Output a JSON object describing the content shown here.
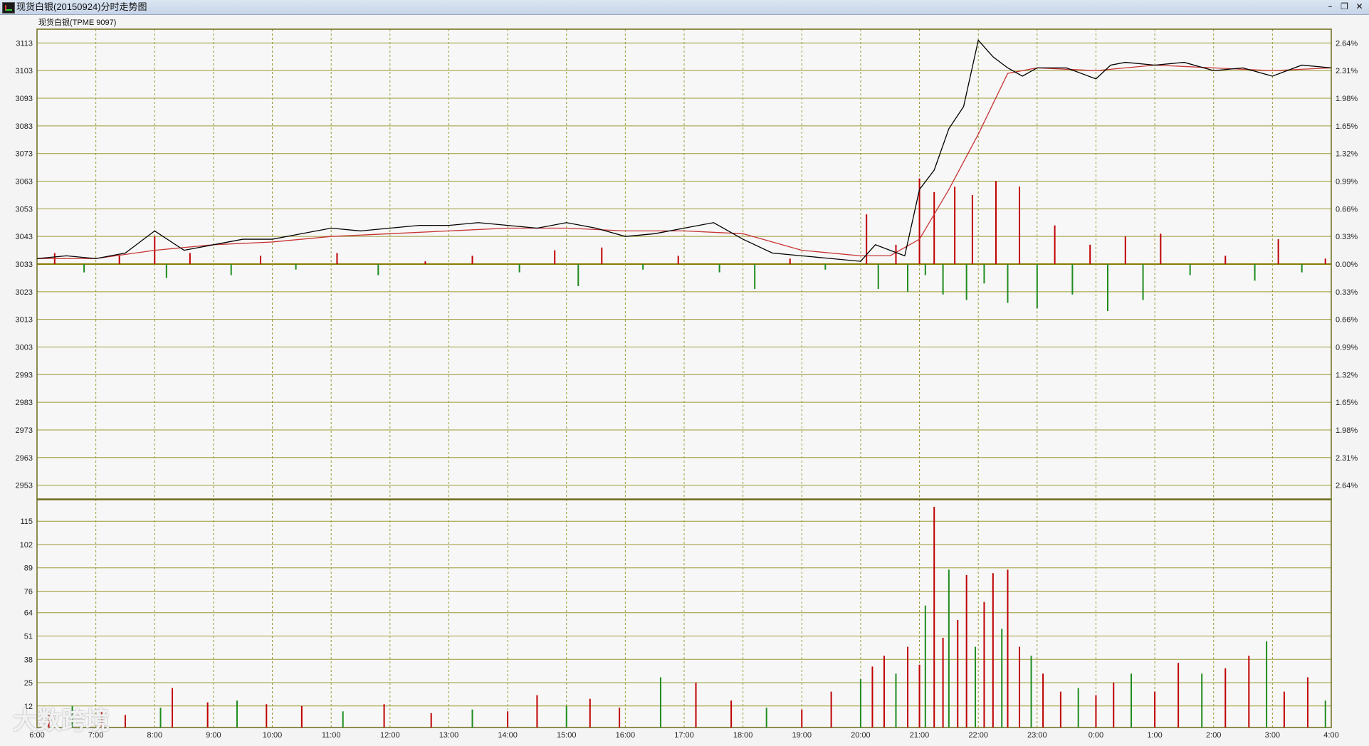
{
  "window": {
    "title": "现货白银(20150924)分时走势图",
    "buttons": {
      "minimize": "–",
      "restore": "❐",
      "close": "✕"
    }
  },
  "chart_label": "现货白银(TPME 9097)",
  "watermark": "大数跨境",
  "colors": {
    "up": "#c00000",
    "down": "#1e8c1e",
    "grid": "#999933",
    "price": "#000000",
    "avg": "#c83232",
    "base": "#8a7a00"
  },
  "chart_data": [
    {
      "type": "line",
      "title": "现货白银(TPME 9097)",
      "x_ticks": [
        "6:00",
        "7:00",
        "8:00",
        "9:00",
        "10:00",
        "11:00",
        "12:00",
        "13:00",
        "14:00",
        "15:00",
        "16:00",
        "17:00",
        "18:00",
        "19:00",
        "20:00",
        "21:00",
        "22:00",
        "23:00",
        "0:00",
        "1:00",
        "2:00",
        "3:00",
        "4:00"
      ],
      "y_ticks_left": [
        "3113",
        "3103",
        "3093",
        "3083",
        "3073",
        "3063",
        "3053",
        "3043",
        "3033",
        "3023",
        "3013",
        "3003",
        "2993",
        "2983",
        "2973",
        "2963",
        "2953"
      ],
      "y_ticks_right": [
        "2.64%",
        "2.31%",
        "1.98%",
        "1.65%",
        "1.32%",
        "0.99%",
        "0.66%",
        "0.33%",
        "0.00%",
        "0.33%",
        "0.66%",
        "0.99%",
        "1.32%",
        "1.65%",
        "1.98%",
        "2.31%",
        "2.64%"
      ],
      "ylim": [
        2948,
        3118
      ],
      "base_price": 3033,
      "grid": true,
      "series": [
        {
          "kind": "price",
          "x": [
            6.0,
            6.5,
            7.0,
            7.5,
            8.0,
            8.5,
            9.0,
            9.5,
            10.0,
            10.5,
            11.0,
            11.5,
            12.0,
            12.5,
            13.0,
            13.5,
            14.0,
            14.5,
            15.0,
            15.5,
            16.0,
            16.5,
            17.0,
            17.5,
            18.0,
            18.5,
            19.0,
            19.5,
            20.0,
            20.25,
            20.5,
            20.75,
            21.0,
            21.25,
            21.5,
            21.75,
            22.0,
            22.25,
            22.5,
            22.75,
            23.0,
            23.5,
            24.0,
            24.25,
            24.5,
            25.0,
            25.5,
            26.0,
            26.5,
            27.0,
            27.5,
            28.0
          ],
          "y": [
            3035,
            3036,
            3035,
            3037,
            3045,
            3038,
            3040,
            3042,
            3042,
            3044,
            3046,
            3045,
            3046,
            3047,
            3047,
            3048,
            3047,
            3046,
            3048,
            3046,
            3043,
            3044,
            3046,
            3048,
            3042,
            3037,
            3036,
            3035,
            3034,
            3040,
            3038,
            3036,
            3060,
            3067,
            3082,
            3090,
            3114,
            3108,
            3104,
            3101,
            3104,
            3104,
            3100,
            3105,
            3106,
            3105,
            3106,
            3103,
            3104,
            3101,
            3105,
            3104
          ]
        },
        {
          "kind": "average",
          "x": [
            6.0,
            7.0,
            8.0,
            9.0,
            10.0,
            11.0,
            12.0,
            13.0,
            14.0,
            15.0,
            16.0,
            17.0,
            18.0,
            19.0,
            20.0,
            20.5,
            21.0,
            21.5,
            22.0,
            22.5,
            23.0,
            24.0,
            25.0,
            26.0,
            27.0,
            28.0
          ],
          "y": [
            3035,
            3035,
            3038,
            3040,
            3041,
            3043,
            3044,
            3045,
            3046,
            3046,
            3045,
            3045,
            3044,
            3038,
            3036,
            3036,
            3042,
            3060,
            3080,
            3102,
            3104,
            3103,
            3105,
            3104,
            3103,
            3104
          ]
        },
        {
          "kind": "price_change_bars",
          "x": [
            6.3,
            6.8,
            7.4,
            8.0,
            8.2,
            8.6,
            9.3,
            9.8,
            10.4,
            11.1,
            11.8,
            12.6,
            13.4,
            14.2,
            14.8,
            15.2,
            15.6,
            16.3,
            16.9,
            17.6,
            18.2,
            18.8,
            19.4,
            20.1,
            20.3,
            20.6,
            20.8,
            21.0,
            21.1,
            21.25,
            21.4,
            21.6,
            21.8,
            21.9,
            22.1,
            22.3,
            22.5,
            22.7,
            23.0,
            23.3,
            23.6,
            23.9,
            24.2,
            24.5,
            24.8,
            25.1,
            25.6,
            26.2,
            26.7,
            27.1,
            27.5,
            27.9
          ],
          "y": [
            3037,
            3030,
            3036,
            3043,
            3028,
            3037,
            3029,
            3036,
            3031,
            3037,
            3029,
            3034,
            3036,
            3030,
            3038,
            3025,
            3039,
            3031,
            3036,
            3030,
            3024,
            3035,
            3031,
            3051,
            3024,
            3040,
            3023,
            3064,
            3029,
            3059,
            3022,
            3061,
            3020,
            3058,
            3026,
            3063,
            3019,
            3061,
            3017,
            3047,
            3022,
            3040,
            3016,
            3043,
            3020,
            3044,
            3029,
            3036,
            3027,
            3042,
            3030,
            3035
          ]
        }
      ]
    },
    {
      "type": "bar",
      "title": "",
      "x_ticks": [
        "6:00",
        "7:00",
        "8:00",
        "9:00",
        "10:00",
        "11:00",
        "12:00",
        "13:00",
        "14:00",
        "15:00",
        "16:00",
        "17:00",
        "18:00",
        "19:00",
        "20:00",
        "21:00",
        "22:00",
        "23:00",
        "0:00",
        "1:00",
        "2:00",
        "3:00",
        "4:00"
      ],
      "y_ticks": [
        "115",
        "102",
        "89",
        "76",
        "64",
        "51",
        "38",
        "25",
        "12"
      ],
      "ylim": [
        0,
        127
      ],
      "grid": true,
      "series": [
        {
          "name": "",
          "x": [
            6.2,
            6.6,
            7.1,
            7.5,
            8.1,
            8.3,
            8.9,
            9.4,
            9.9,
            10.5,
            11.2,
            11.9,
            12.7,
            13.4,
            14.0,
            14.5,
            15.0,
            15.4,
            15.9,
            16.6,
            17.2,
            17.8,
            18.4,
            19.0,
            19.5,
            20.0,
            20.2,
            20.4,
            20.6,
            20.8,
            21.0,
            21.1,
            21.25,
            21.4,
            21.5,
            21.65,
            21.8,
            21.95,
            22.1,
            22.25,
            22.4,
            22.5,
            22.7,
            22.9,
            23.1,
            23.4,
            23.7,
            24.0,
            24.3,
            24.6,
            25.0,
            25.4,
            25.8,
            26.2,
            26.6,
            26.9,
            27.2,
            27.6,
            27.9
          ],
          "values": [
            8,
            12,
            10,
            7,
            11,
            22,
            14,
            15,
            13,
            12,
            9,
            13,
            8,
            10,
            9,
            18,
            12,
            16,
            11,
            28,
            25,
            15,
            11,
            10,
            20,
            27,
            34,
            40,
            30,
            45,
            35,
            68,
            123,
            50,
            88,
            60,
            85,
            45,
            70,
            86,
            55,
            88,
            45,
            40,
            30,
            20,
            22,
            18,
            25,
            30,
            20,
            36,
            30,
            33,
            40,
            48,
            20,
            28,
            15
          ]
        }
      ]
    }
  ]
}
